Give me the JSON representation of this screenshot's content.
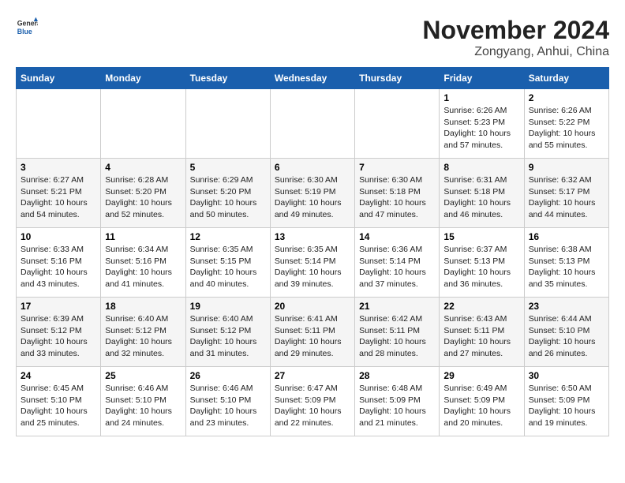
{
  "logo": {
    "general": "General",
    "blue": "Blue"
  },
  "title": "November 2024",
  "location": "Zongyang, Anhui, China",
  "headers": [
    "Sunday",
    "Monday",
    "Tuesday",
    "Wednesday",
    "Thursday",
    "Friday",
    "Saturday"
  ],
  "weeks": [
    [
      {
        "day": "",
        "info": ""
      },
      {
        "day": "",
        "info": ""
      },
      {
        "day": "",
        "info": ""
      },
      {
        "day": "",
        "info": ""
      },
      {
        "day": "",
        "info": ""
      },
      {
        "day": "1",
        "info": "Sunrise: 6:26 AM\nSunset: 5:23 PM\nDaylight: 10 hours\nand 57 minutes."
      },
      {
        "day": "2",
        "info": "Sunrise: 6:26 AM\nSunset: 5:22 PM\nDaylight: 10 hours\nand 55 minutes."
      }
    ],
    [
      {
        "day": "3",
        "info": "Sunrise: 6:27 AM\nSunset: 5:21 PM\nDaylight: 10 hours\nand 54 minutes."
      },
      {
        "day": "4",
        "info": "Sunrise: 6:28 AM\nSunset: 5:20 PM\nDaylight: 10 hours\nand 52 minutes."
      },
      {
        "day": "5",
        "info": "Sunrise: 6:29 AM\nSunset: 5:20 PM\nDaylight: 10 hours\nand 50 minutes."
      },
      {
        "day": "6",
        "info": "Sunrise: 6:30 AM\nSunset: 5:19 PM\nDaylight: 10 hours\nand 49 minutes."
      },
      {
        "day": "7",
        "info": "Sunrise: 6:30 AM\nSunset: 5:18 PM\nDaylight: 10 hours\nand 47 minutes."
      },
      {
        "day": "8",
        "info": "Sunrise: 6:31 AM\nSunset: 5:18 PM\nDaylight: 10 hours\nand 46 minutes."
      },
      {
        "day": "9",
        "info": "Sunrise: 6:32 AM\nSunset: 5:17 PM\nDaylight: 10 hours\nand 44 minutes."
      }
    ],
    [
      {
        "day": "10",
        "info": "Sunrise: 6:33 AM\nSunset: 5:16 PM\nDaylight: 10 hours\nand 43 minutes."
      },
      {
        "day": "11",
        "info": "Sunrise: 6:34 AM\nSunset: 5:16 PM\nDaylight: 10 hours\nand 41 minutes."
      },
      {
        "day": "12",
        "info": "Sunrise: 6:35 AM\nSunset: 5:15 PM\nDaylight: 10 hours\nand 40 minutes."
      },
      {
        "day": "13",
        "info": "Sunrise: 6:35 AM\nSunset: 5:14 PM\nDaylight: 10 hours\nand 39 minutes."
      },
      {
        "day": "14",
        "info": "Sunrise: 6:36 AM\nSunset: 5:14 PM\nDaylight: 10 hours\nand 37 minutes."
      },
      {
        "day": "15",
        "info": "Sunrise: 6:37 AM\nSunset: 5:13 PM\nDaylight: 10 hours\nand 36 minutes."
      },
      {
        "day": "16",
        "info": "Sunrise: 6:38 AM\nSunset: 5:13 PM\nDaylight: 10 hours\nand 35 minutes."
      }
    ],
    [
      {
        "day": "17",
        "info": "Sunrise: 6:39 AM\nSunset: 5:12 PM\nDaylight: 10 hours\nand 33 minutes."
      },
      {
        "day": "18",
        "info": "Sunrise: 6:40 AM\nSunset: 5:12 PM\nDaylight: 10 hours\nand 32 minutes."
      },
      {
        "day": "19",
        "info": "Sunrise: 6:40 AM\nSunset: 5:12 PM\nDaylight: 10 hours\nand 31 minutes."
      },
      {
        "day": "20",
        "info": "Sunrise: 6:41 AM\nSunset: 5:11 PM\nDaylight: 10 hours\nand 29 minutes."
      },
      {
        "day": "21",
        "info": "Sunrise: 6:42 AM\nSunset: 5:11 PM\nDaylight: 10 hours\nand 28 minutes."
      },
      {
        "day": "22",
        "info": "Sunrise: 6:43 AM\nSunset: 5:11 PM\nDaylight: 10 hours\nand 27 minutes."
      },
      {
        "day": "23",
        "info": "Sunrise: 6:44 AM\nSunset: 5:10 PM\nDaylight: 10 hours\nand 26 minutes."
      }
    ],
    [
      {
        "day": "24",
        "info": "Sunrise: 6:45 AM\nSunset: 5:10 PM\nDaylight: 10 hours\nand 25 minutes."
      },
      {
        "day": "25",
        "info": "Sunrise: 6:46 AM\nSunset: 5:10 PM\nDaylight: 10 hours\nand 24 minutes."
      },
      {
        "day": "26",
        "info": "Sunrise: 6:46 AM\nSunset: 5:10 PM\nDaylight: 10 hours\nand 23 minutes."
      },
      {
        "day": "27",
        "info": "Sunrise: 6:47 AM\nSunset: 5:09 PM\nDaylight: 10 hours\nand 22 minutes."
      },
      {
        "day": "28",
        "info": "Sunrise: 6:48 AM\nSunset: 5:09 PM\nDaylight: 10 hours\nand 21 minutes."
      },
      {
        "day": "29",
        "info": "Sunrise: 6:49 AM\nSunset: 5:09 PM\nDaylight: 10 hours\nand 20 minutes."
      },
      {
        "day": "30",
        "info": "Sunrise: 6:50 AM\nSunset: 5:09 PM\nDaylight: 10 hours\nand 19 minutes."
      }
    ]
  ]
}
